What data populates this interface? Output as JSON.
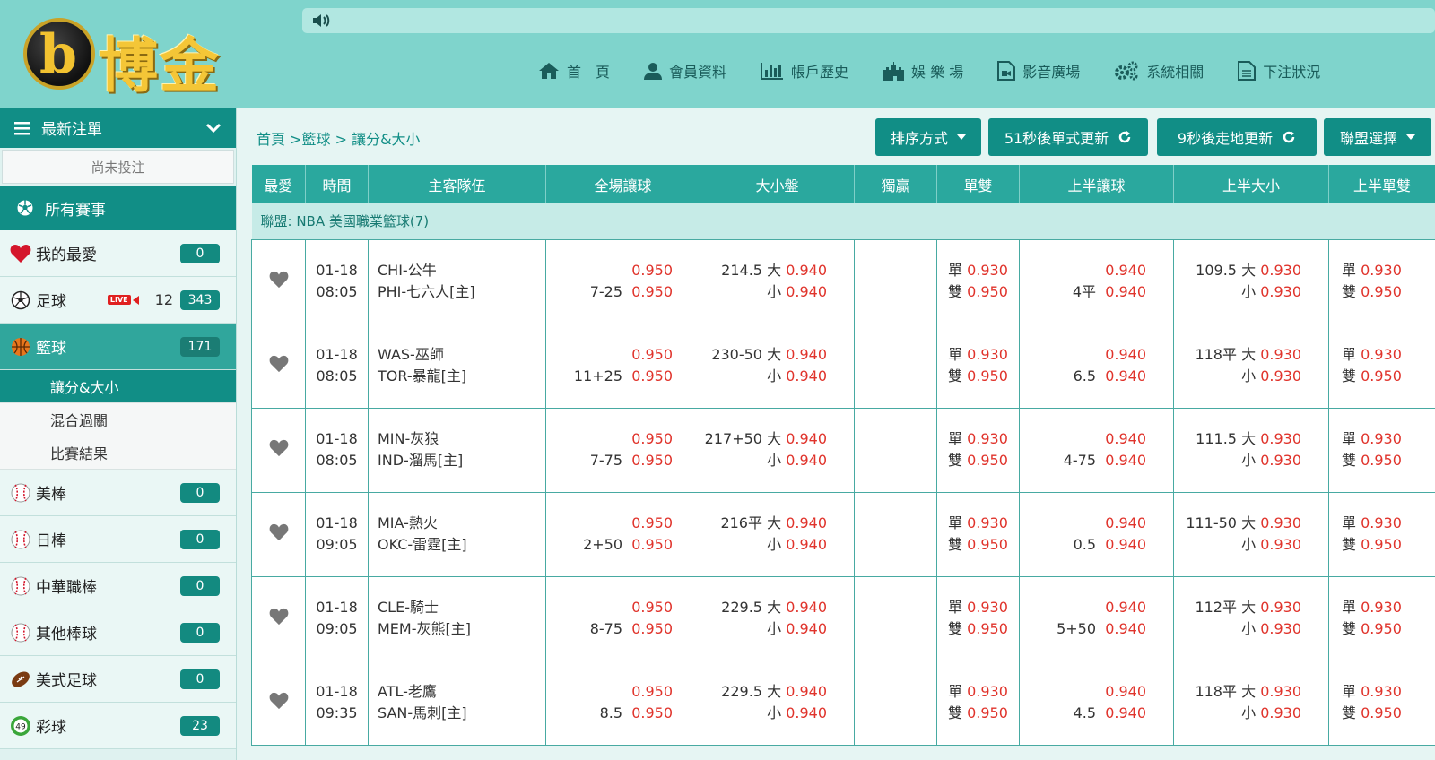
{
  "header": {
    "logo_letter": "b",
    "logo_text": "博金",
    "nav": [
      {
        "label": "首　頁",
        "icon": "home-icon"
      },
      {
        "label": "會員資料",
        "icon": "user-icon"
      },
      {
        "label": "帳戶歷史",
        "icon": "bar-chart-icon"
      },
      {
        "label": "娛 樂 場",
        "icon": "castle-icon"
      },
      {
        "label": "影音廣場",
        "icon": "video-file-icon"
      },
      {
        "label": "系統相關",
        "icon": "gears-icon"
      },
      {
        "label": "下注狀況",
        "icon": "document-icon"
      }
    ]
  },
  "sidebar": {
    "latest_orders": "最新注單",
    "no_bets": "尚未投注",
    "all_events": "所有賽事",
    "items": [
      {
        "label": "我的最愛",
        "icon": "heart-icon",
        "count": "0"
      },
      {
        "label": "足球",
        "icon": "soccer-ball-icon",
        "live_label": "LIVE",
        "live_count": "12",
        "count": "343"
      },
      {
        "label": "籃球",
        "icon": "basketball-icon",
        "count": "171"
      },
      {
        "label": "美棒",
        "icon": "baseball-icon",
        "count": "0"
      },
      {
        "label": "日棒",
        "icon": "baseball-icon",
        "count": "0"
      },
      {
        "label": "中華職棒",
        "icon": "baseball-icon",
        "count": "0"
      },
      {
        "label": "其他棒球",
        "icon": "baseball-icon",
        "count": "0"
      },
      {
        "label": "美式足球",
        "icon": "american-football-icon",
        "count": "0"
      },
      {
        "label": "彩球",
        "icon": "lottery-ball-icon",
        "icon_text": "49",
        "count": "23"
      }
    ],
    "basketball_sub": [
      "讓分&大小",
      "混合過關",
      "比賽結果"
    ]
  },
  "main": {
    "breadcrumb": "首頁 >籃球 > 讓分&大小",
    "sort_label": "排序方式",
    "refresh_single": "51秒後單式更新",
    "refresh_live": "9秒後走地更新",
    "league_select": "聯盟選擇",
    "columns": [
      "最愛",
      "時間",
      "主客隊伍",
      "全場讓球",
      "大小盤",
      "獨贏",
      "單雙",
      "上半讓球",
      "上半大小",
      "上半單雙"
    ],
    "league": "聯盟: NBA 美國職業籃球(7)",
    "big": "大",
    "small": "小",
    "odd_label": "單",
    "even_label": "雙",
    "rows": [
      {
        "date": "01-18",
        "time": "08:05",
        "away": "CHI-公牛",
        "home": "PHI-七六人[主]",
        "hc_line": "7-25",
        "hc_o1": "0.950",
        "hc_o2": "0.950",
        "ou_line": "214.5",
        "ou_o1": "0.940",
        "ou_o2": "0.940",
        "oe_o1": "0.930",
        "oe_o2": "0.950",
        "h1hc_line": "4平",
        "h1hc_o1": "0.940",
        "h1hc_o2": "0.940",
        "h1ou_line": "109.5",
        "h1ou_o1": "0.930",
        "h1ou_o2": "0.930",
        "h1oe_o1": "0.930",
        "h1oe_o2": "0.950"
      },
      {
        "date": "01-18",
        "time": "08:05",
        "away": "WAS-巫師",
        "home": "TOR-暴龍[主]",
        "hc_line": "11+25",
        "hc_o1": "0.950",
        "hc_o2": "0.950",
        "ou_line": "230-50",
        "ou_o1": "0.940",
        "ou_o2": "0.940",
        "oe_o1": "0.930",
        "oe_o2": "0.950",
        "h1hc_line": "6.5",
        "h1hc_o1": "0.940",
        "h1hc_o2": "0.940",
        "h1ou_line": "118平",
        "h1ou_o1": "0.930",
        "h1ou_o2": "0.930",
        "h1oe_o1": "0.930",
        "h1oe_o2": "0.950"
      },
      {
        "date": "01-18",
        "time": "08:05",
        "away": "MIN-灰狼",
        "home": "IND-溜馬[主]",
        "hc_line": "7-75",
        "hc_o1": "0.950",
        "hc_o2": "0.950",
        "ou_line": "217+50",
        "ou_o1": "0.940",
        "ou_o2": "0.940",
        "oe_o1": "0.930",
        "oe_o2": "0.950",
        "h1hc_line": "4-75",
        "h1hc_o1": "0.940",
        "h1hc_o2": "0.940",
        "h1ou_line": "111.5",
        "h1ou_o1": "0.930",
        "h1ou_o2": "0.930",
        "h1oe_o1": "0.930",
        "h1oe_o2": "0.950"
      },
      {
        "date": "01-18",
        "time": "09:05",
        "away": "MIA-熱火",
        "home": "OKC-雷霆[主]",
        "hc_line": "2+50",
        "hc_o1": "0.950",
        "hc_o2": "0.950",
        "ou_line": "216平",
        "ou_o1": "0.940",
        "ou_o2": "0.940",
        "oe_o1": "0.930",
        "oe_o2": "0.950",
        "h1hc_line": "0.5",
        "h1hc_o1": "0.940",
        "h1hc_o2": "0.940",
        "h1ou_line": "111-50",
        "h1ou_o1": "0.930",
        "h1ou_o2": "0.930",
        "h1oe_o1": "0.930",
        "h1oe_o2": "0.950"
      },
      {
        "date": "01-18",
        "time": "09:05",
        "away": "CLE-騎士",
        "home": "MEM-灰熊[主]",
        "hc_line": "8-75",
        "hc_o1": "0.950",
        "hc_o2": "0.950",
        "ou_line": "229.5",
        "ou_o1": "0.940",
        "ou_o2": "0.940",
        "oe_o1": "0.930",
        "oe_o2": "0.950",
        "h1hc_line": "5+50",
        "h1hc_o1": "0.940",
        "h1hc_o2": "0.940",
        "h1ou_line": "112平",
        "h1ou_o1": "0.930",
        "h1ou_o2": "0.930",
        "h1oe_o1": "0.930",
        "h1oe_o2": "0.950"
      },
      {
        "date": "01-18",
        "time": "09:35",
        "away": "ATL-老鷹",
        "home": "SAN-馬刺[主]",
        "hc_line": "8.5",
        "hc_o1": "0.950",
        "hc_o2": "0.950",
        "ou_line": "229.5",
        "ou_o1": "0.940",
        "ou_o2": "0.940",
        "oe_o1": "0.930",
        "oe_o2": "0.950",
        "h1hc_line": "4.5",
        "h1hc_o1": "0.940",
        "h1hc_o2": "0.940",
        "h1ou_line": "118平",
        "h1ou_o1": "0.930",
        "h1ou_o2": "0.930",
        "h1oe_o1": "0.930",
        "h1oe_o2": "0.950"
      }
    ]
  },
  "colors": {
    "teal_dark": "#118e86",
    "teal_header": "#7fd4cc",
    "odds_red": "#e0332b",
    "logo_gold": "#f4c637"
  }
}
